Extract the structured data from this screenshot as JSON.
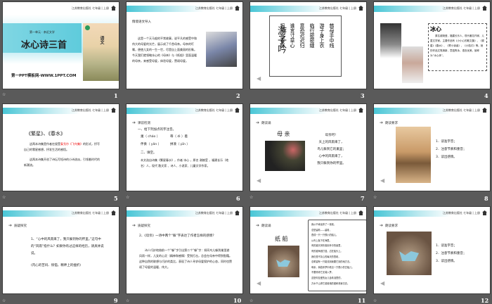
{
  "header": {
    "publisher": "江苏教育出版社 七年级 | 上册"
  },
  "transition_icon": "star-transition-icon",
  "slides": [
    {
      "number": "1",
      "unit": "第一单元 · 亲近文学",
      "title": "冰心诗三首",
      "site": "第一PPT模板网-WWW.1PPT.COM",
      "book": "语文"
    },
    {
      "number": "2",
      "section": "情境语文导入",
      "body": "这是一个天马般的平常故事，说平凡的感受中和伟大的母爱的光芒，展示成了千首母亲。母亲的叮嘱，便使儿女的一生一世，尽是自上面美丽的形象。今天我们就领略冰心的《母亲》与《纸船》里面温暖的母亲，来感受母爱，体验母爱，赞颂母爱。"
    },
    {
      "number": "3",
      "poem_title": "游子吟",
      "poem_columns": [
        "慈母手中线",
        "游子身上衣",
        "临行密密缝",
        "意恐迟迟归",
        "谁言寸草心",
        "报得三春晖"
      ]
    },
    {
      "number": "4",
      "name": "冰心",
      "body": "原名谢婉莹，福建长乐人，现代著名作家、儿童文学家。主要作品有《小小心的散文集》、《繁星》《春水》、《寄小读者》、《小桔灯》等。她的作品文笔清新，意蕴隽永，语言优美，被称为“冰心体”。"
    },
    {
      "number": "5",
      "title": "《繁星》、《春水》",
      "p1a": "这两本诗集是作者在接受",
      "p1red": "泰戈尔《飞鸟集》",
      "p1b": "的形式，抒写自己的零星感想，抒发生活的感悟。",
      "p2": "这两本诗集开创了诗坛写短诗的小诗流派，引领着时代的新潮流。"
    },
    {
      "number": "6",
      "section": "课前检测",
      "q1": "一、给下列加点的字注音。",
      "w1": "巢（ cháo ）",
      "w2": "蒂（ dì ）着",
      "w3": "伴奏（ yǎn ）",
      "w4": "拼凑（ pīn ）",
      "q2": "二、填空。",
      "fill": "本文选自诗集《繁星春水》，作者 冰心 ，原名 谢婉莹 ，福建长乐（地名）人，现代 散文家 、诗人、小说家、儿童文学作家。"
    },
    {
      "number": "7",
      "section": "朗读诵",
      "title": "母 亲",
      "lines": [
        "母亲呵！",
        "天上的风雨来了，",
        "鸟儿躲到它的巢里；",
        "心中的风雨来了，",
        "我只躲到你的怀里。"
      ]
    },
    {
      "number": "8",
      "section": "朗读要求",
      "items": [
        "1．读准字音；",
        "2．注意节奏和重音；",
        "3．读出感情。"
      ]
    },
    {
      "number": "9",
      "section": "质疑探究",
      "question": "1、“心中的风雨来了，我只躲到你的怀里。”这句中的“风雨”指什么？如果你有过这样的经历，请具体说说。",
      "answer": "(内心的苦闷、烦恼，精神上的挫折)"
    },
    {
      "number": "10",
      "section": "质疑探究",
      "question": "2、《母亲》一诗中两个“躲”字表达了作者怎样的感情？",
      "answer": "诗人巧妙地借前一个“躲”字引出第二个“躲”字：如同鸟儿躲到巢里避风雨一样，儿女的心灵（精神和感情）受到打击，总会在母亲中得到慰藉。这种自然的联想与巧妙的类比，表现了诗人寻求母爱保护的心态，同时也赞颂了母爱的温暖、伟大。"
    },
    {
      "number": "11",
      "section": "朗读诵",
      "title": "纸 船",
      "lines": [
        "我从不肯妄弃了一张纸，",
        "总是留着——留着，",
        "叠成一只一只很小的船儿，",
        "从舟上抛下在海里。",
        "有的被天风吹卷到舟中的窗里，",
        "有的被海浪打湿，沾在船头上。",
        "我仍是不灰心的每天的叠着，",
        "总希望有一只能流到我要它到的地方去。",
        "母亲，倘若你梦中看见一只很小的白船儿，",
        "不要惊讶它无端入梦。",
        "这是你至爱的女儿含着泪叠的，",
        "万水千山求它载着她的爱和悲哀归去。"
      ]
    },
    {
      "number": "12",
      "section": "朗读要求",
      "items": [
        "1．读准字音；",
        "2．注意节奏和重音；",
        "3．读出感情。"
      ]
    }
  ]
}
